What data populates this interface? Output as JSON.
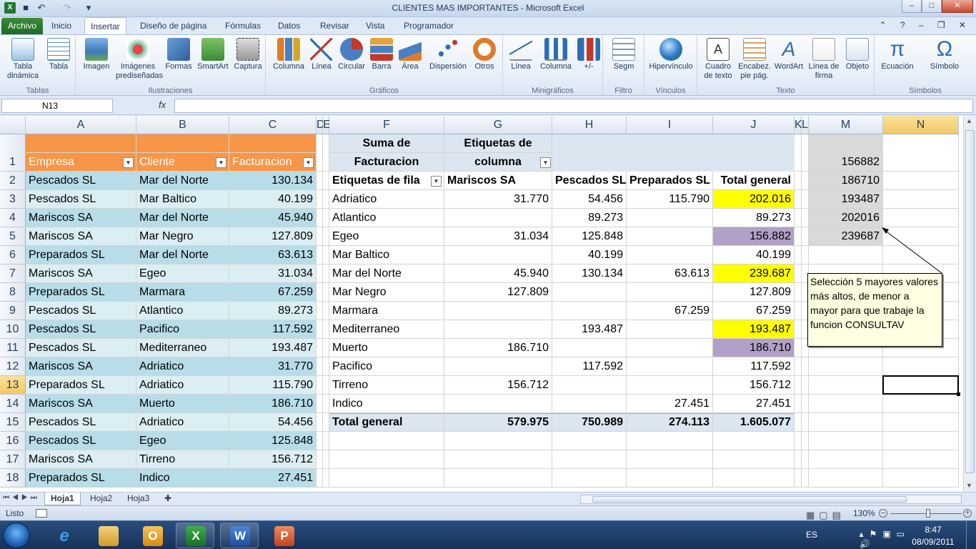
{
  "window": {
    "title": "CLIENTES MAS IMPORTANTES  -  Microsoft Excel",
    "min": "–",
    "max": "□",
    "close": "✕"
  },
  "tabs": [
    "Archivo",
    "Inicio",
    "Insertar",
    "Diseño de página",
    "Fórmulas",
    "Datos",
    "Revisar",
    "Vista",
    "Programador"
  ],
  "ribbon": {
    "groups": {
      "tablas": "Tablas",
      "ilustraciones": "Ilustraciones",
      "graficos": "Gráficos",
      "minigraficos": "Minigráficos",
      "filtro": "Filtro",
      "vinculos": "Vínculos",
      "texto": "Texto",
      "simbolos": "Símbolos"
    },
    "buttons": {
      "tabla_dinamica": "Tabla dinámica",
      "tabla": "Tabla",
      "imagen": "Imagen",
      "imagenes_predisenadas": "Imágenes prediseñadas",
      "formas": "Formas",
      "smartart": "SmartArt",
      "captura": "Captura",
      "columna": "Columna",
      "linea": "Línea",
      "circular": "Circular",
      "barra": "Barra",
      "area": "Área",
      "dispersion": "Dispersión",
      "otros": "Otros",
      "mini_linea": "Línea",
      "mini_columna": "Columna",
      "mini_pm": "+/-",
      "segm": "Segm",
      "hipervinculo": "Hipervínculo",
      "cuadro_texto": "Cuadro de texto",
      "encabez": "Encabez. pie pág.",
      "wordart": "WordArt",
      "linea_firma": "Línea de firma",
      "objeto": "Objeto",
      "ecuacion": "Ecuación",
      "simbolo": "Símbolo"
    }
  },
  "formula_bar": {
    "name_box": "N13",
    "fx": "fx",
    "value": ""
  },
  "columns": [
    "A",
    "B",
    "C",
    "D",
    "E",
    "F",
    "G",
    "H",
    "I",
    "J",
    "K",
    "L",
    "M",
    "N"
  ],
  "rows": [
    "1",
    "2",
    "3",
    "4",
    "5",
    "6",
    "7",
    "8",
    "9",
    "10",
    "11",
    "12",
    "13",
    "14",
    "15",
    "16",
    "17",
    "18"
  ],
  "table": {
    "headers": [
      "Empresa",
      "Cliente",
      "Facturacion"
    ],
    "rows": [
      [
        "Pescados SL",
        "Mar del Norte",
        "130.134"
      ],
      [
        "Pescados SL",
        "Mar Baltico",
        "40.199"
      ],
      [
        "Mariscos SA",
        "Mar del Norte",
        "45.940"
      ],
      [
        "Mariscos SA",
        "Mar Negro",
        "127.809"
      ],
      [
        "Preparados SL",
        "Mar del Norte",
        "63.613"
      ],
      [
        "Mariscos SA",
        "Egeo",
        "31.034"
      ],
      [
        "Preparados SL",
        "Marmara",
        "67.259"
      ],
      [
        "Pescados SL",
        "Atlantico",
        "89.273"
      ],
      [
        "Pescados SL",
        "Pacifico",
        "117.592"
      ],
      [
        "Pescados SL",
        "Mediterraneo",
        "193.487"
      ],
      [
        "Mariscos SA",
        "Adriatico",
        "31.770"
      ],
      [
        "Preparados SL",
        "Adriatico",
        "115.790"
      ],
      [
        "Mariscos SA",
        "Muerto",
        "186.710"
      ],
      [
        "Pescados SL",
        "Adriatico",
        "54.456"
      ],
      [
        "Pescados SL",
        "Egeo",
        "125.848"
      ],
      [
        "Mariscos SA",
        "Tirreno",
        "156.712"
      ],
      [
        "Preparados SL",
        "Indico",
        "27.451"
      ]
    ]
  },
  "pivot": {
    "value_label_1": "Suma de",
    "value_label_2": "Facturacion",
    "col_label_1": "Etiquetas de",
    "col_label_2": "columna",
    "row_label": "Etiquetas de fila",
    "col_headers": [
      "Mariscos SA",
      "Pescados SL",
      "Preparados SL",
      "Total general"
    ],
    "rows": [
      {
        "label": "Adriatico",
        "values": [
          "31.770",
          "54.456",
          "115.790",
          "202.016"
        ],
        "hl": "yellow"
      },
      {
        "label": "Atlantico",
        "values": [
          "",
          "89.273",
          "",
          "89.273"
        ],
        "hl": ""
      },
      {
        "label": "Egeo",
        "values": [
          "31.034",
          "125.848",
          "",
          "156.882"
        ],
        "hl": "purple"
      },
      {
        "label": "Mar Baltico",
        "values": [
          "",
          "40.199",
          "",
          "40.199"
        ],
        "hl": ""
      },
      {
        "label": "Mar del Norte",
        "values": [
          "45.940",
          "130.134",
          "63.613",
          "239.687"
        ],
        "hl": "yellow"
      },
      {
        "label": "Mar Negro",
        "values": [
          "127.809",
          "",
          "",
          "127.809"
        ],
        "hl": ""
      },
      {
        "label": "Marmara",
        "values": [
          "",
          "",
          "67.259",
          "67.259"
        ],
        "hl": ""
      },
      {
        "label": "Mediterraneo",
        "values": [
          "",
          "193.487",
          "",
          "193.487"
        ],
        "hl": "yellow"
      },
      {
        "label": "Muerto",
        "values": [
          "186.710",
          "",
          "",
          "186.710"
        ],
        "hl": "purple"
      },
      {
        "label": "Pacifico",
        "values": [
          "",
          "117.592",
          "",
          "117.592"
        ],
        "hl": ""
      },
      {
        "label": "Tirreno",
        "values": [
          "156.712",
          "",
          "",
          "156.712"
        ],
        "hl": ""
      },
      {
        "label": "Indico",
        "values": [
          "",
          "",
          "27.451",
          "27.451"
        ],
        "hl": ""
      }
    ],
    "total_label": "Total general",
    "totals": [
      "579.975",
      "750.989",
      "274.113",
      "1.605.077"
    ]
  },
  "top5": [
    "156882",
    "186710",
    "193487",
    "202016",
    "239687"
  ],
  "comment": "Selección 5 mayores valores más altos, de menor a mayor para que trabaje la funcion CONSULTAV",
  "colors": {
    "orange": "#f79646",
    "blue1": "#b7dde8",
    "blue2": "#dbeef3",
    "yellow": "#ffff00",
    "purple": "#b1a0c7",
    "gray": "#d9d9d9",
    "pivot": "#dce6f1"
  },
  "sheets": [
    "Hoja1",
    "Hoja2",
    "Hoja3"
  ],
  "status": {
    "ready": "Listo",
    "zoom": "130%"
  },
  "tray": {
    "lang": "ES",
    "time": "8:47",
    "date": "08/09/2011"
  }
}
